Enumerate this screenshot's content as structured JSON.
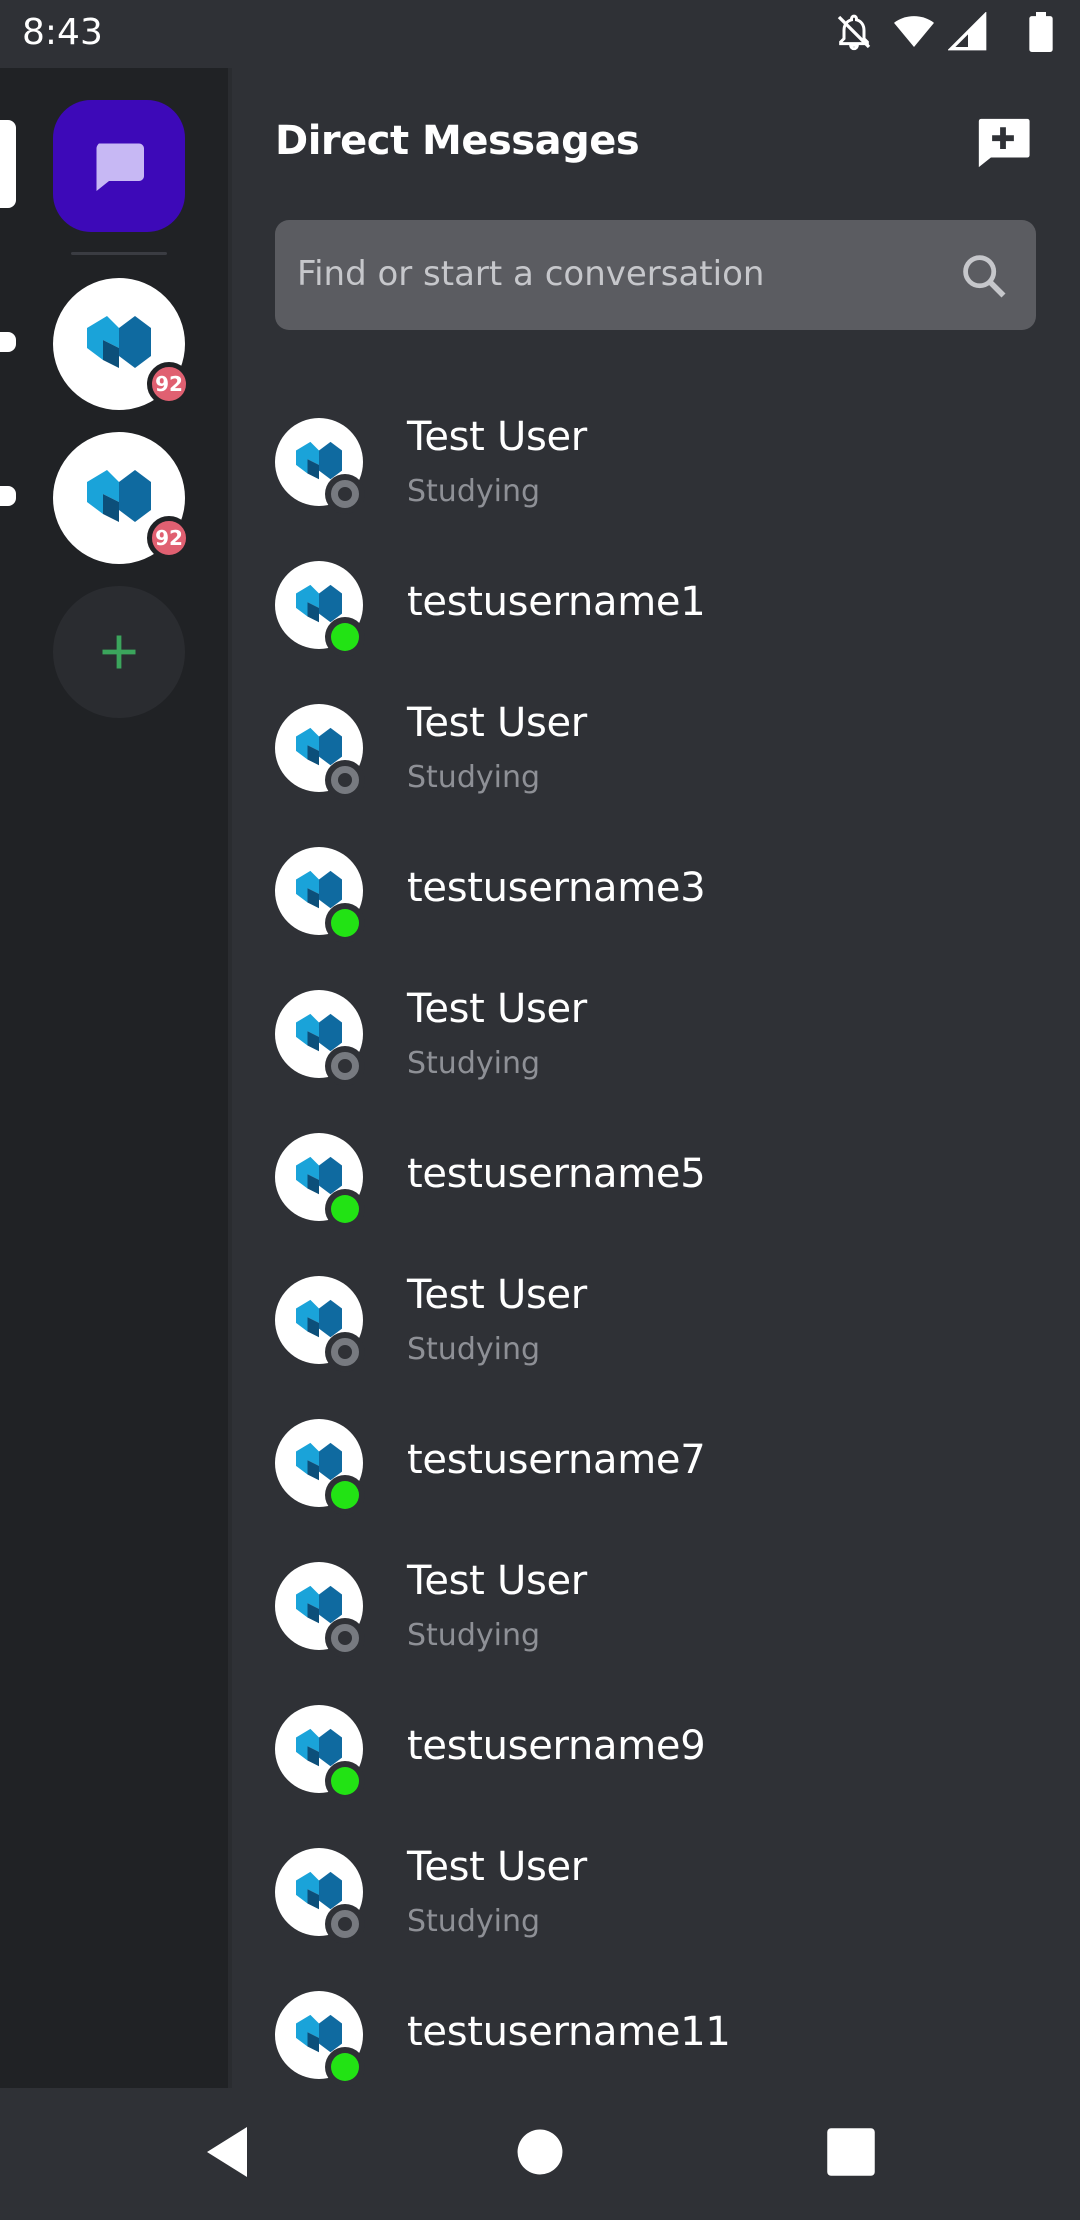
{
  "status_bar": {
    "time": "8:43",
    "icons": [
      "notifications-off-icon",
      "wifi-icon",
      "signal-icon",
      "battery-icon"
    ]
  },
  "rail": {
    "home_icon": "chat-bubble-icon",
    "servers": [
      {
        "badge": "92"
      },
      {
        "badge": "92"
      }
    ],
    "add_server_icon": "plus-icon"
  },
  "header": {
    "title": "Direct Messages",
    "new_dm_icon": "new-message-icon"
  },
  "search": {
    "placeholder": "Find or start a conversation",
    "icon": "search-icon"
  },
  "conversations": [
    {
      "name": "Test User",
      "activity": "Studying",
      "status": "offline"
    },
    {
      "name": "testusername1",
      "activity": "",
      "status": "online"
    },
    {
      "name": "Test User",
      "activity": "Studying",
      "status": "offline"
    },
    {
      "name": "testusername3",
      "activity": "",
      "status": "online"
    },
    {
      "name": "Test User",
      "activity": "Studying",
      "status": "offline"
    },
    {
      "name": "testusername5",
      "activity": "",
      "status": "online"
    },
    {
      "name": "Test User",
      "activity": "Studying",
      "status": "offline"
    },
    {
      "name": "testusername7",
      "activity": "",
      "status": "online"
    },
    {
      "name": "Test User",
      "activity": "Studying",
      "status": "offline"
    },
    {
      "name": "testusername9",
      "activity": "",
      "status": "online"
    },
    {
      "name": "Test User",
      "activity": "Studying",
      "status": "offline"
    },
    {
      "name": "testusername11",
      "activity": "",
      "status": "online"
    }
  ],
  "colors": {
    "background": "#2f3136",
    "rail": "#202225",
    "accent": "#3d09b8",
    "online": "#22e314",
    "badge": "#e06071"
  },
  "nav_bar": {
    "icons": [
      "back-icon",
      "home-icon",
      "recents-icon"
    ]
  }
}
